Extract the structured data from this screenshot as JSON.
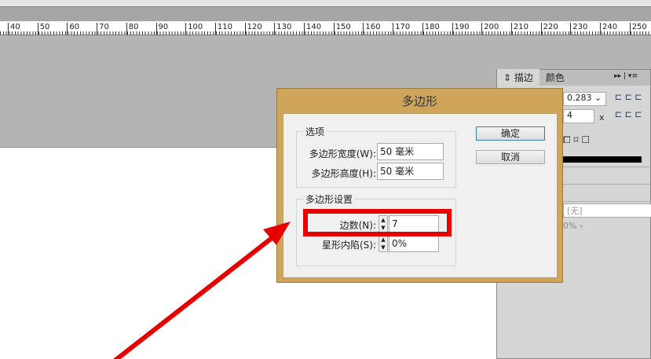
{
  "ruler": {
    "ticks": [
      "40",
      "50",
      "60",
      "70",
      "80",
      "90",
      "100",
      "110",
      "120",
      "130",
      "140",
      "150",
      "160",
      "170",
      "180",
      "190",
      "200",
      "210",
      "220",
      "230",
      "240",
      "250"
    ]
  },
  "panel": {
    "tabs": [
      "描边",
      "颜色"
    ],
    "weight": "0.283",
    "miter": "4",
    "miter_unit": "x",
    "none_label": "[无]",
    "percent": "0%"
  },
  "dialog": {
    "title": "多边形",
    "options_legend": "选项",
    "width_label": "多边形宽度(W):",
    "width_value": "50 毫米",
    "height_label": "多边形高度(H):",
    "height_value": "50 毫米",
    "settings_legend": "多边形设置",
    "sides_label": "边数(N):",
    "sides_value": "7",
    "inset_label": "星形内陷(S):",
    "inset_value": "0%",
    "ok": "确定",
    "cancel": "取消"
  },
  "colors": {
    "highlight": "#e60000",
    "dialog_frame": "#cfa55c"
  }
}
